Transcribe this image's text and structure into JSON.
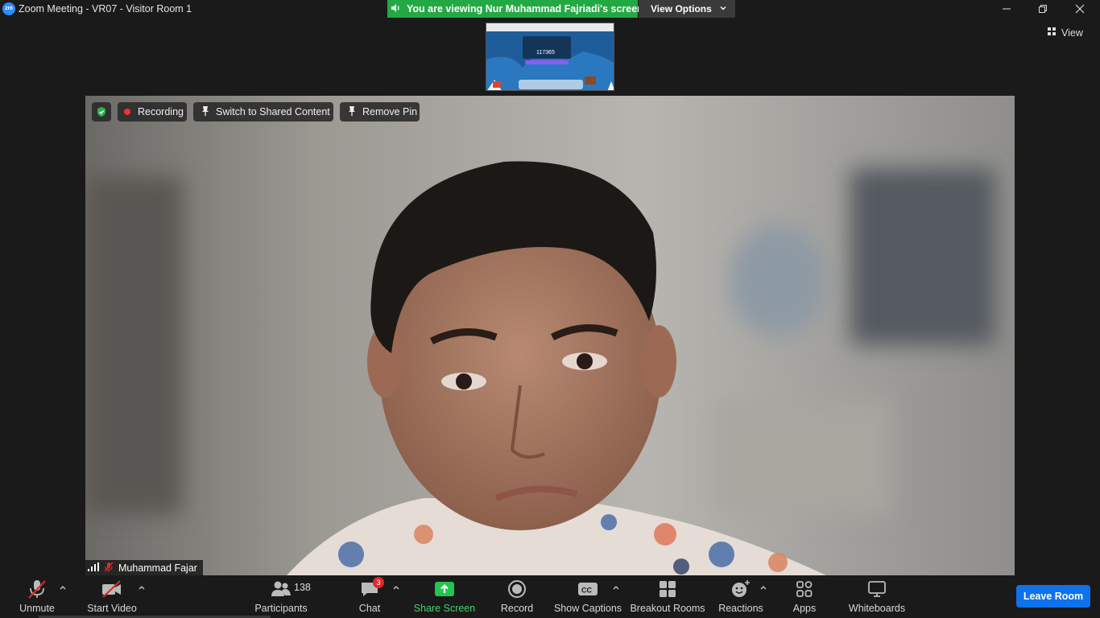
{
  "window": {
    "logo_text": "zm",
    "title": "Zoom Meeting - VR07 - Visitor Room 1",
    "controls": [
      "minimize-icon",
      "restore-icon",
      "close-icon"
    ]
  },
  "share_banner": {
    "text": "You are viewing Nur Muhammad Fajriadi's screen",
    "view_options_label": "View Options",
    "color": "#23a944"
  },
  "shared_thumbnail": {
    "meeting_code": "117365"
  },
  "view_button": {
    "label": "View"
  },
  "video_controls": {
    "recording_label": "Recording",
    "switch_label": "Switch to Shared Content",
    "remove_pin_label": "Remove Pin"
  },
  "participant": {
    "name": "Muhammad Fajar",
    "muted": true
  },
  "toolbar": {
    "unmute": "Unmute",
    "start_video": "Start Video",
    "participants": "Participants",
    "participants_count": "138",
    "chat": "Chat",
    "chat_badge": "3",
    "share_screen": "Share Screen",
    "record": "Record",
    "show_captions": "Show Captions",
    "breakout_rooms": "Breakout Rooms",
    "reactions": "Reactions",
    "apps": "Apps",
    "whiteboards": "Whiteboards",
    "leave": "Leave Room"
  },
  "colors": {
    "accent_green": "#23a944",
    "leave_blue": "#0e72ed",
    "mute_red": "#e02828"
  }
}
